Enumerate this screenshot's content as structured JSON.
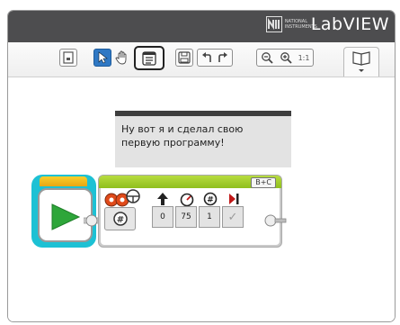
{
  "window": {
    "brand_small": "NATIONAL INSTRUMENTS",
    "brand_name": "LabVIEW"
  },
  "toolbar": {
    "zoom_reset_label": "1:1",
    "icons": [
      "program-properties-icon",
      "select-icon",
      "pan-hand-icon",
      "comment-icon",
      "save-icon",
      "undo-icon",
      "redo-icon",
      "zoom-out-icon",
      "zoom-in-icon",
      "zoom-reset-icon",
      "content-editor-icon"
    ]
  },
  "comment": {
    "text": "Ну вот я и сделал свою первую программу!"
  },
  "move_block": {
    "ports": "B+C",
    "steering": "0",
    "power": "75",
    "rotations": "1",
    "brake": "✓"
  },
  "colors": {
    "titlebar": "#4d4d4f",
    "start_block": "#1dc1d4",
    "start_arrow": "#2ea63a",
    "move_block_header": "#9cc92a",
    "selected_tool": "#2f78c4"
  }
}
